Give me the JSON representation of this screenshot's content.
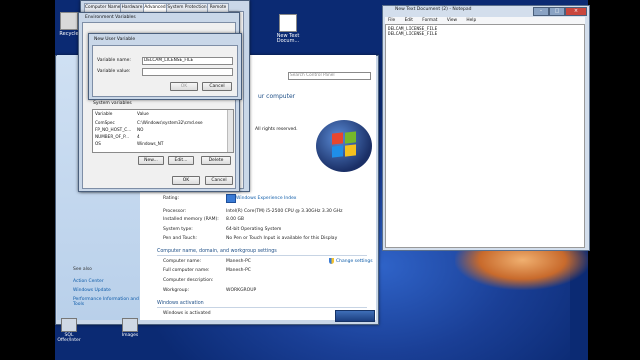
{
  "desktop": {
    "icons": [
      {
        "label": "Recycle"
      },
      {
        "label": "New Text Docum..."
      }
    ],
    "taskbar_icons": [
      {
        "label": "SQL Offer/Inter"
      },
      {
        "label": "Images"
      }
    ]
  },
  "sys_props": {
    "tabs": [
      "Computer Name",
      "Hardware",
      "Advanced",
      "System Protection",
      "Remote"
    ],
    "active_tab": "Advanced"
  },
  "env_vars": {
    "title": "Environment Variables",
    "system_vars_label": "System variables",
    "columns": [
      "Variable",
      "Value"
    ],
    "rows": [
      {
        "name": "ComSpec",
        "value": "C:\\Windows\\system32\\cmd.exe"
      },
      {
        "name": "FP_NO_HOST_C...",
        "value": "NO"
      },
      {
        "name": "NUMBER_OF_P...",
        "value": "4"
      },
      {
        "name": "OS",
        "value": "Windows_NT"
      }
    ],
    "new_label": "New...",
    "edit_label": "Edit...",
    "delete_label": "Delete",
    "ok_label": "OK",
    "cancel_label": "Cancel"
  },
  "new_user_var": {
    "title": "New User Variable",
    "name_label": "Variable name:",
    "name_value": "DELCAM_LICENSE_FILE",
    "value_label": "Variable value:",
    "value_value": "",
    "ok_label": "OK",
    "cancel_label": "Cancel"
  },
  "system": {
    "search_placeholder": "Search Control Panel",
    "heading": "ur computer",
    "rights": "All rights reserved.",
    "experience_link": "Windows Experience Index",
    "rows": [
      {
        "label": "Rating:",
        "value": ""
      },
      {
        "label": "Processor:",
        "value": "Intel(R) Core(TM) i5-2500 CPU @ 3.30GHz   3.30 GHz"
      },
      {
        "label": "Installed memory (RAM):",
        "value": "8.00 GB"
      },
      {
        "label": "System type:",
        "value": "64-bit Operating System"
      },
      {
        "label": "Pen and Touch:",
        "value": "No Pen or Touch Input is available for this Display"
      }
    ],
    "section_computer": "Computer name, domain, and workgroup settings",
    "computer_rows": [
      {
        "label": "Computer name:",
        "value": "Manesh-PC"
      },
      {
        "label": "Full computer name:",
        "value": "Manesh-PC"
      },
      {
        "label": "Computer description:",
        "value": ""
      },
      {
        "label": "Workgroup:",
        "value": "WORKGROUP"
      }
    ],
    "change_settings": "Change settings",
    "section_activation": "Windows activation",
    "activated": "Windows is activated",
    "sidebar_see_also": "See also",
    "sidebar_links": [
      "Action Center",
      "Windows Update",
      "Performance Information and Tools"
    ]
  },
  "notepad": {
    "title": "New Text Document (2) - Notepad",
    "menu": [
      "File",
      "Edit",
      "Format",
      "View",
      "Help"
    ],
    "lines": [
      "DELCAM_LICENSE_FILE",
      "DELCAM_LICENSE_FILE"
    ]
  }
}
